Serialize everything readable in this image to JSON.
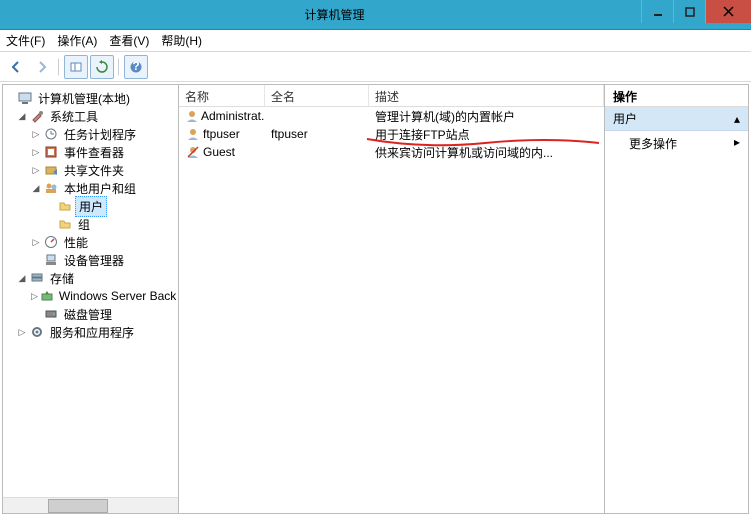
{
  "window": {
    "title": "计算机管理"
  },
  "menu": {
    "file": "文件(F)",
    "action": "操作(A)",
    "view": "查看(V)",
    "help": "帮助(H)"
  },
  "tree": {
    "root": "计算机管理(本地)",
    "system_tools": "系统工具",
    "task_scheduler": "任务计划程序",
    "event_viewer": "事件查看器",
    "shared_folders": "共享文件夹",
    "local_users_groups": "本地用户和组",
    "users": "用户",
    "groups": "组",
    "performance": "性能",
    "device_manager": "设备管理器",
    "storage": "存储",
    "windows_backup": "Windows Server Back",
    "disk_management": "磁盘管理",
    "services": "服务和应用程序"
  },
  "columns": {
    "name": "名称",
    "fullname": "全名",
    "description": "描述"
  },
  "users": [
    {
      "name": "Administrat...",
      "fullname": "",
      "desc": "管理计算机(域)的内置帐户"
    },
    {
      "name": "ftpuser",
      "fullname": "ftpuser",
      "desc": "用于连接FTP站点"
    },
    {
      "name": "Guest",
      "fullname": "",
      "desc": "供来宾访问计算机或访问域的内..."
    }
  ],
  "actions": {
    "header": "操作",
    "group": "用户",
    "more": "更多操作"
  },
  "col_widths": {
    "name": 86,
    "fullname": 104,
    "desc": 230
  },
  "glyphs": {
    "chevron": "▸"
  }
}
